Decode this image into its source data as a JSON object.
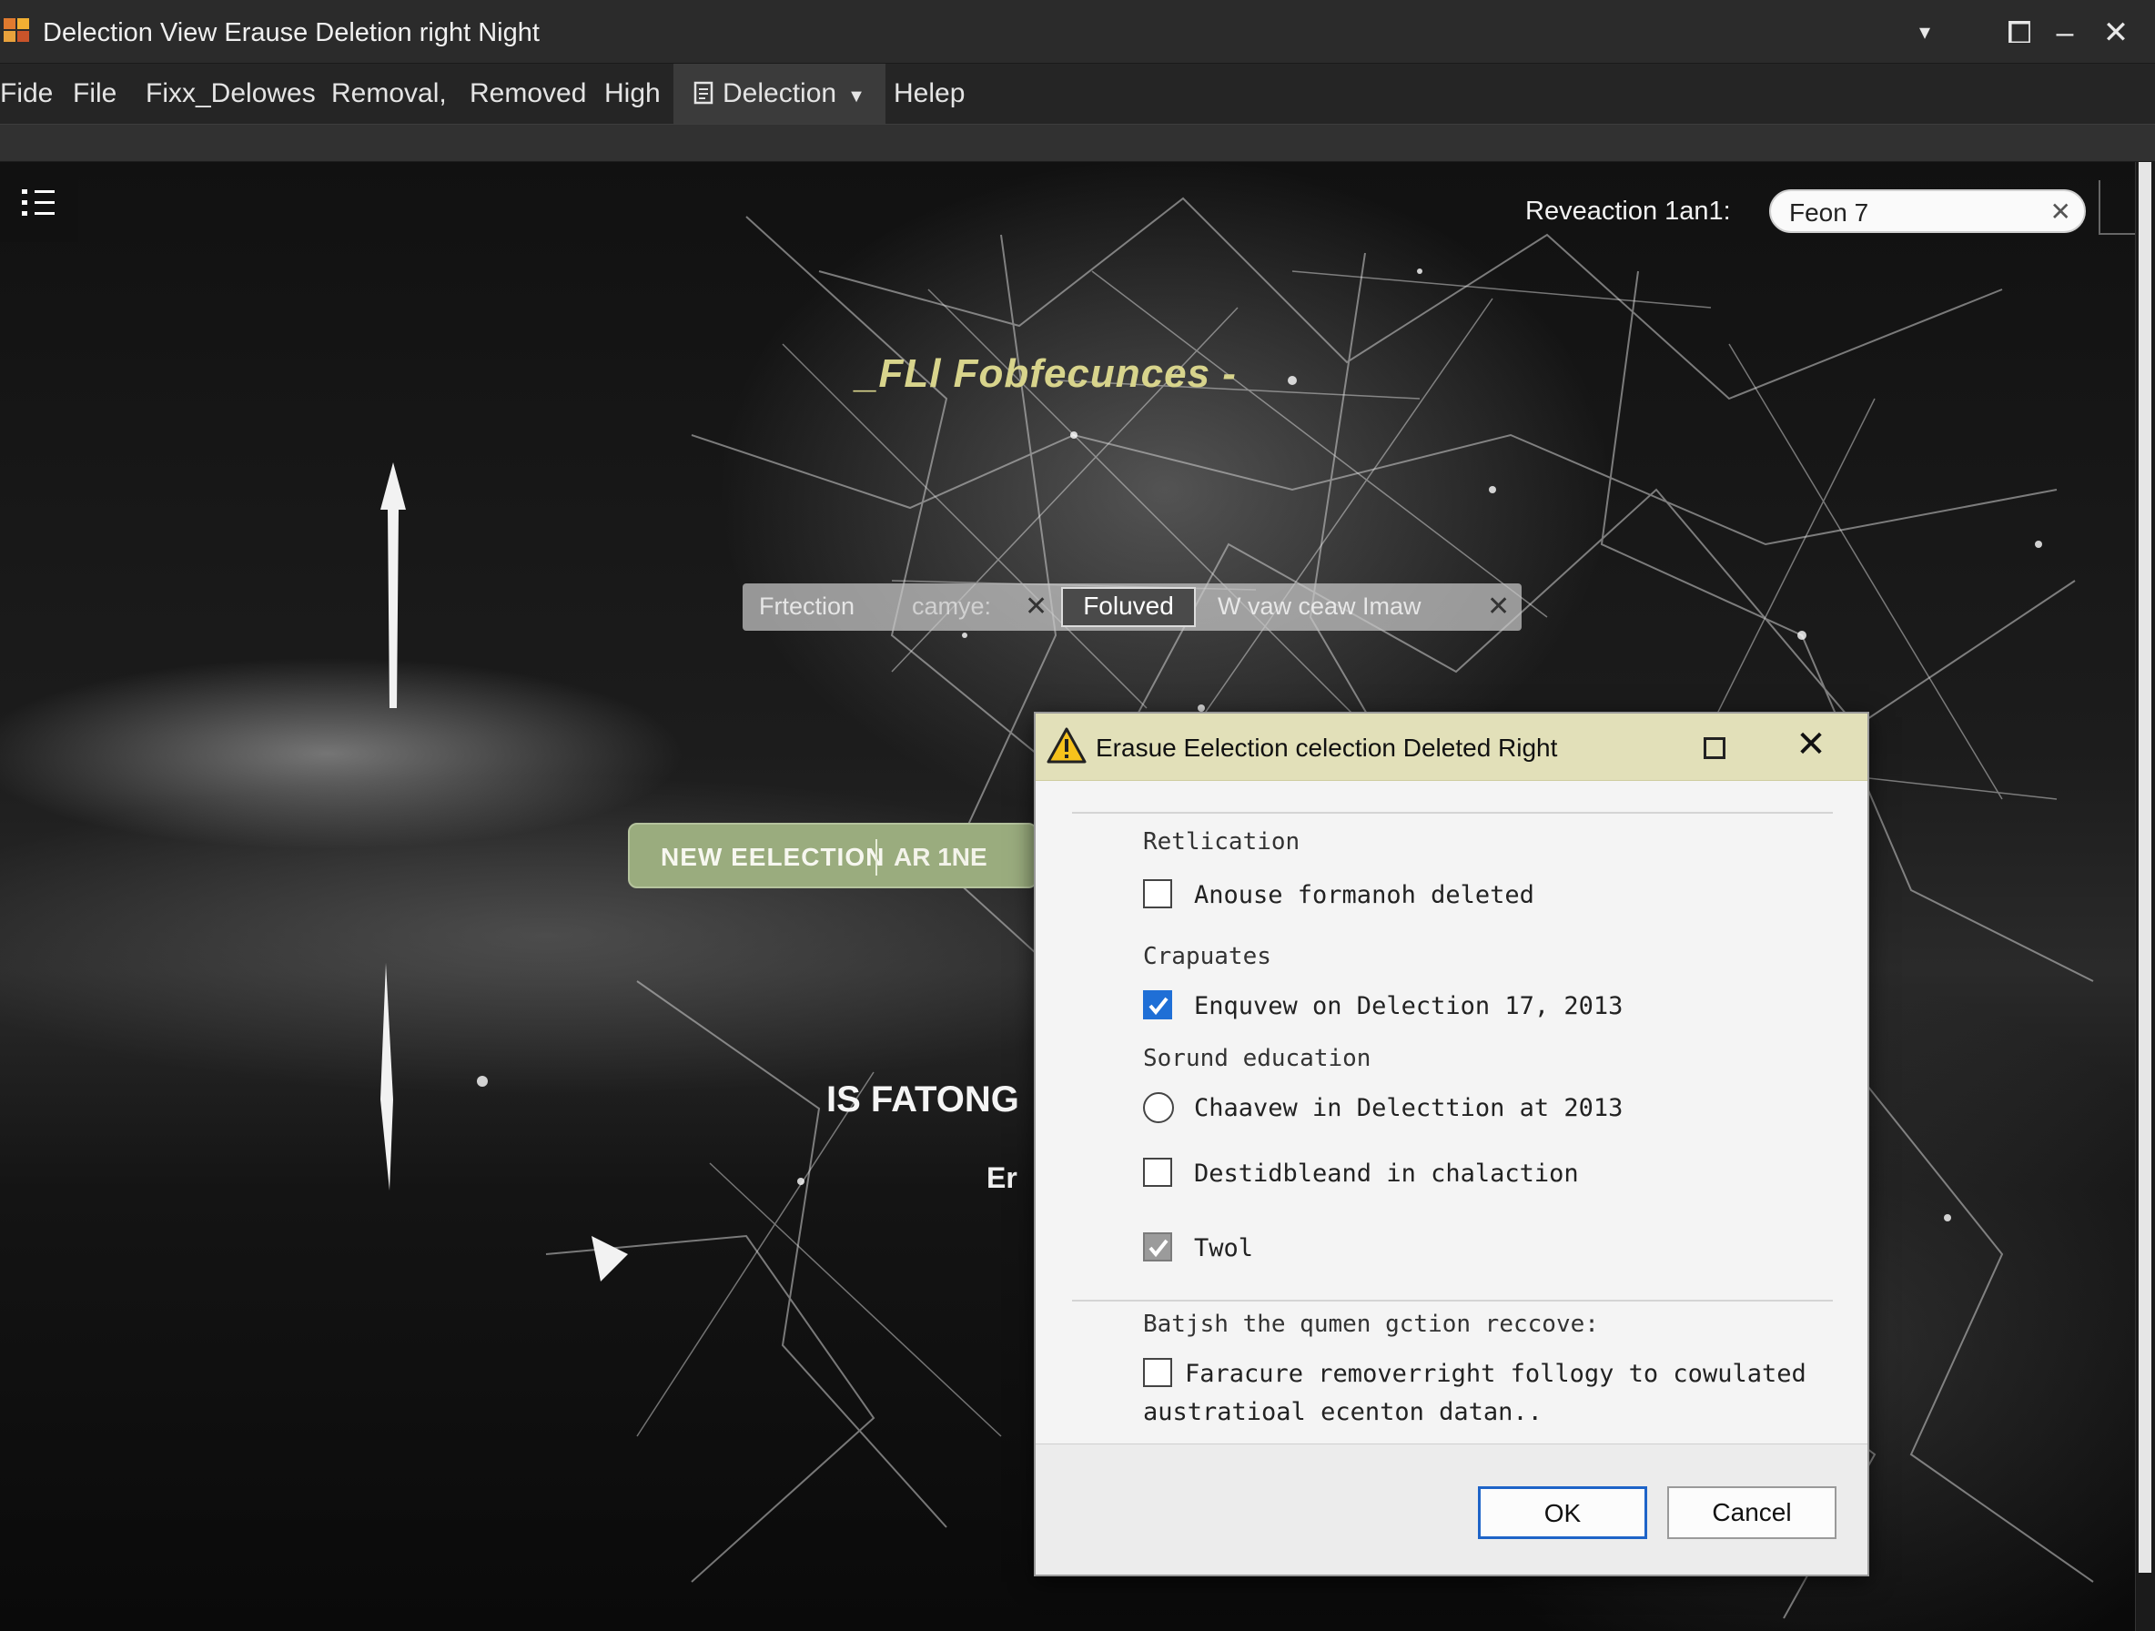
{
  "window": {
    "title": "Delection View Erause Deletion right Night",
    "controls": {
      "dropdown": "▾",
      "restore": "⧠",
      "minimize": "–",
      "close": "✕"
    }
  },
  "menu": {
    "items": [
      "Fide",
      "File",
      "Fixx_Delowes",
      "Removal,",
      "Removed",
      "High"
    ],
    "active_label": "Delection",
    "help": "Helep"
  },
  "canvas": {
    "reveaction_label": "Reveaction  1an1:",
    "search_value": "Feon 7",
    "overlay_title": "_FLl Fobfecunces -",
    "tags": {
      "first": "Frtection",
      "first_faded": "camye:",
      "active": "Foluved",
      "after": "W vaw ceaw Imaw"
    },
    "new_election": {
      "label": "NEW EELECTION",
      "extra": "AR 1NE"
    },
    "heading": "IS FATONG",
    "subtext": "Er"
  },
  "dialog": {
    "title": "Erasue Eelection celection Deleted Right",
    "sections": [
      {
        "label": "Retlication"
      },
      {
        "label": "Crapuates"
      },
      {
        "label": "Sorund education"
      },
      {
        "label": "Batjsh the qumen gction reccove:"
      }
    ],
    "options": [
      {
        "label": "Anouse formanoh deleted",
        "type": "checkbox",
        "checked": false
      },
      {
        "label": "Enquvew on Delection 17, 2013",
        "type": "checkbox",
        "checked": true
      },
      {
        "label": "Chaavew in Delecttion at 2013",
        "type": "radio",
        "checked": false
      },
      {
        "label": "Destidbleand in chalaction",
        "type": "checkbox",
        "checked": false
      },
      {
        "label": "Twol",
        "type": "checkbox",
        "checked": true,
        "disabled": true
      },
      {
        "label": "Faracure removerright follogy to cowulated",
        "type": "checkbox",
        "checked": false
      }
    ],
    "option6_continuation": "austratioal ecenton datan..",
    "buttons": {
      "ok": "OK",
      "cancel": "Cancel"
    }
  },
  "colors": {
    "dialog_title_bg": "#e2e0b9",
    "accent_blue": "#1f6fd6",
    "overlay_title": "#d8d48c",
    "new_election_bg": "#9aac7e"
  }
}
